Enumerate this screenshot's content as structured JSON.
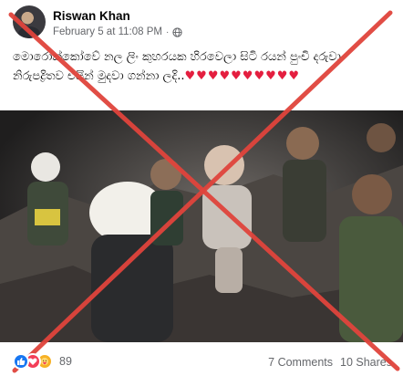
{
  "post": {
    "author": "Riswan Khan",
    "timestamp": "February 5 at 11:08 PM",
    "separator": "·",
    "caption_text": "මොරොක්කෝවේ නල ලිං කුහරයක හිරවෙලා සිටි රයන් පුංචි දරුවා නිරුපද්‍රිතව එයින් මුදවා ගන්නා ලදි..",
    "caption_hearts": "♥♥♥♥♥♥♥♥♥♥"
  },
  "footer": {
    "reaction_count": "89",
    "comments": "7 Comments",
    "shares": "10 Shares"
  },
  "icons": {
    "avatar": "avatar",
    "privacy": "globe-icon",
    "like": "like-icon",
    "love": "love-icon",
    "care": "care-icon"
  },
  "colors": {
    "overlay_x": "#e0443c",
    "heart": "#e41e3f",
    "like_blue": "#1877f2",
    "meta_gray": "#65676b"
  }
}
